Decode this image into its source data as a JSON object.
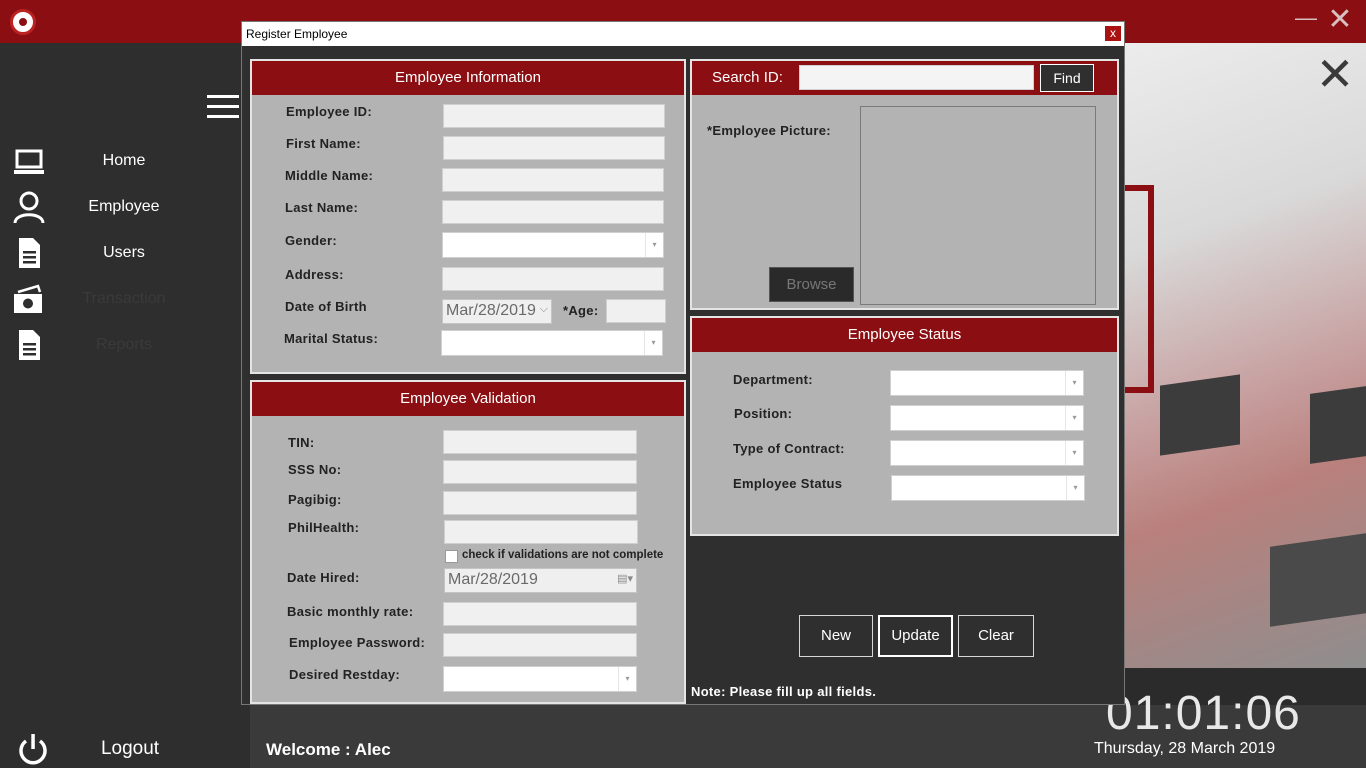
{
  "app": {
    "nav": [
      {
        "label": "Home",
        "icon": "laptop-icon",
        "enabled": true
      },
      {
        "label": "Employee",
        "icon": "user-icon",
        "enabled": true
      },
      {
        "label": "Users",
        "icon": "document-icon",
        "enabled": true
      },
      {
        "label": "Transaction",
        "icon": "cash-icon",
        "enabled": false
      },
      {
        "label": "Reports",
        "icon": "report-icon",
        "enabled": false
      }
    ],
    "logout_label": "Logout",
    "welcome": "Welcome : Alec",
    "clock": "01:01:06",
    "date": "Thursday, 28 March 2019"
  },
  "dialog": {
    "title": "Register Employee",
    "close_glyph": "x",
    "info": {
      "header": "Employee Information",
      "employee_id_label": "Employee ID:",
      "first_name_label": "First Name:",
      "middle_name_label": "Middle Name:",
      "last_name_label": "Last Name:",
      "gender_label": "Gender:",
      "address_label": "Address:",
      "dob_label": "Date of Birth",
      "dob_value": "Mar/28/2019",
      "age_label": "*Age:",
      "marital_label": "Marital Status:"
    },
    "search": {
      "label": "Search ID:",
      "find_label": "Find",
      "picture_label": "*Employee Picture:",
      "browse_label": "Browse"
    },
    "validation": {
      "header": "Employee Validation",
      "tin_label": "TIN:",
      "sss_label": "SSS No:",
      "pagibig_label": "Pagibig:",
      "philhealth_label": "PhilHealth:",
      "check_label": "check if validations are not complete",
      "date_hired_label": "Date Hired:",
      "date_hired_value": "Mar/28/2019",
      "basic_rate_label": "Basic monthly rate:",
      "password_label": "Employee Password:",
      "restday_label": "Desired Restday:"
    },
    "status": {
      "header": "Employee Status",
      "department_label": "Department:",
      "position_label": "Position:",
      "contract_label": "Type of Contract:",
      "status_label": "Employee Status"
    },
    "buttons": {
      "new": "New",
      "update": "Update",
      "clear": "Clear"
    },
    "note": "Note: Please fill up all fields."
  },
  "colors": {
    "accent": "#8b0f12",
    "panel": "#b3b3b3",
    "sidebar": "#2e2e2e"
  }
}
